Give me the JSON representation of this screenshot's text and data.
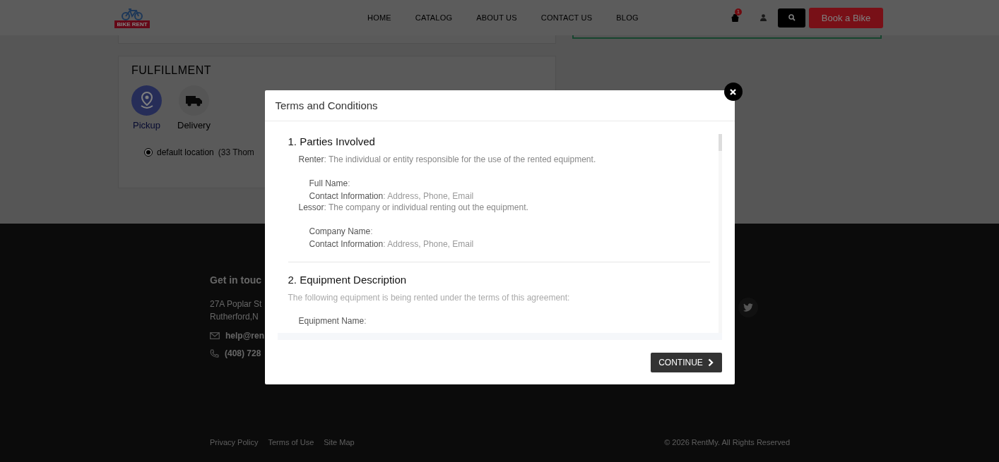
{
  "header": {
    "logo_text": "BIKE RENT",
    "nav": [
      {
        "label": "HOME"
      },
      {
        "label": "CATALOG"
      },
      {
        "label": "ABOUT US"
      },
      {
        "label": "CONTACT US"
      },
      {
        "label": "BLOG"
      }
    ],
    "cart_count": "1",
    "book_button": "Book a Bike"
  },
  "fulfillment": {
    "title": "FULFILLMENT",
    "options": [
      {
        "label": "Pickup",
        "kind": "pickup",
        "selected": true
      },
      {
        "label": "Delivery",
        "kind": "delivery",
        "selected": false
      }
    ],
    "location": {
      "label": "default location",
      "detail": "(33 Thom",
      "selected": true
    }
  },
  "footer": {
    "contact_heading": "Get in touc",
    "address_lines": [
      "27A Poplar St",
      "Rutherford,N"
    ],
    "email": "help@ren",
    "phone": "(408) 728",
    "links": [
      "Privacy Policy",
      "Terms of Use",
      "Site Map"
    ],
    "copyright": "© 2026 RentMy. All Rights Reserved"
  },
  "modal": {
    "title": "Terms and Conditions",
    "sections": [
      {
        "heading": "1. Parties Involved",
        "items": [
          {
            "text": "**Renter**: The individual or entity responsible for the use of the rented equipment.",
            "children": [
              {
                "text": "**Full Name**:"
              },
              {
                "text": "**Contact Information**: Address, Phone, Email"
              }
            ]
          },
          {
            "text": "**Lessor**: The company or individual renting out the equipment.",
            "children": [
              {
                "text": "**Company Name**:"
              },
              {
                "text": "**Contact Information**: Address, Phone, Email"
              }
            ]
          }
        ]
      },
      {
        "heading": "2. Equipment Description",
        "intro": "The following equipment is being rented under the terms of this agreement:",
        "items": [
          {
            "text": "**Equipment Name**:"
          }
        ]
      }
    ],
    "button": "CONTINUE"
  }
}
